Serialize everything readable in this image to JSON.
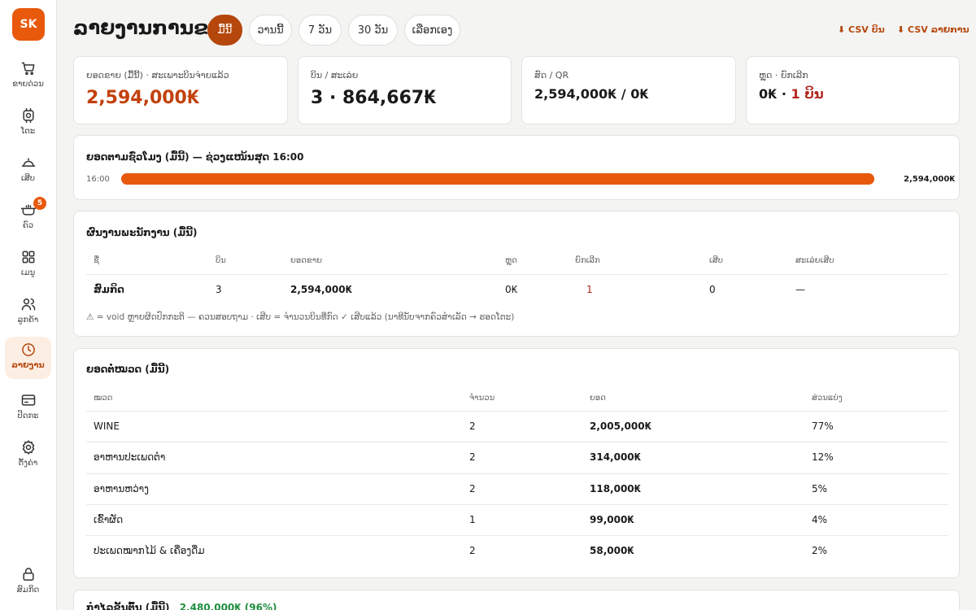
{
  "app": {
    "logo": "SK"
  },
  "sidebar": {
    "items": [
      {
        "label": "ຂາຍດ່ວນ",
        "icon": "cart-icon"
      },
      {
        "label": "ໂຕະ",
        "icon": "table-icon"
      },
      {
        "label": "ເສີບ",
        "icon": "cloche-icon"
      },
      {
        "label": "ຄົວ",
        "icon": "pot-icon",
        "badge": "5"
      },
      {
        "label": "ເມນູ",
        "icon": "grid-icon"
      },
      {
        "label": "ລູກຄ້າ",
        "icon": "users-icon"
      },
      {
        "label": "ລາຍງານ",
        "icon": "clock-icon",
        "active": true
      },
      {
        "label": "ປິດກະ",
        "icon": "card-icon"
      },
      {
        "label": "ຕັ້ງຄ່າ",
        "icon": "gear-icon"
      }
    ],
    "user": {
      "label": "ສົມກິດ",
      "icon": "lock-icon"
    }
  },
  "header": {
    "title": "ລາຍງານການຂາຍ",
    "ranges": [
      "ມື້ນີ້",
      "ວານນີ້",
      "7 ວັນ",
      "30 ວັນ",
      "ເລືອກເອງ"
    ],
    "active_range": "ມື້ນີ້",
    "csv_bills": "⬇ CSV ບິນ",
    "csv_items": "⬇ CSV ລາຍການ"
  },
  "stats": [
    {
      "label": "ຍອດຂາຍ (ມື້ນີ້) · ສະເພາະບິນຈ່າຍແລ້ວ",
      "value": "2,594,000₭"
    },
    {
      "label": "ບິນ / ສະເລ່ຍ",
      "value": "3 · 864,667₭"
    },
    {
      "label": "ສົດ / QR",
      "value": "2,594,000₭ / 0₭"
    },
    {
      "label": "ຫຼຸດ · ຍົກເລີກ",
      "value_main": "0₭ · ",
      "value_alert": "1 ບິນ"
    }
  ],
  "hourly": {
    "title": "ຍອດຕາມຊົ່ວໂມງ (ມື້ນີ້) — ຊ່ວງແໜ້ນສຸດ 16:00",
    "rows": [
      {
        "hour": "16:00",
        "value_label": "2,594,000₭",
        "fraction": 1.0
      }
    ]
  },
  "staff": {
    "title": "ຜົນງານພະນັກງານ (ມື້ນີ້)",
    "headers": [
      "ຊື່",
      "ບິນ",
      "ຍອດຂາຍ",
      "ຫຼຸດ",
      "ຍົກເລີກ",
      "ເສີບ",
      "ສະເລ່ຍເສີບ"
    ],
    "rows": [
      {
        "name": "ສົມກິດ",
        "bills": "3",
        "sales": "2,594,000₭",
        "discount": "0₭",
        "cancel": "1",
        "served": "0",
        "avg_serve": "—"
      }
    ],
    "note": "⚠ = void ຫຼາຍຜິດປົກກະຕິ — ຄວນສອບຖາມ · ເສີບ = ຈຳນວນບິນທີ່ກົດ ✓ ເສີບແລ້ວ (ນາທີນັບຈາກຄົວສຳເລັດ → ຮອດໂຕະ)"
  },
  "category": {
    "title": "ຍອດຕໍ່ໝວດ (ມື້ນີ້)",
    "headers": [
      "ໝວດ",
      "ຈຳນວນ",
      "ຍອດ",
      "ສ່ວນແບ່ງ"
    ],
    "rows": [
      {
        "name": "WINE",
        "qty": "2",
        "amount": "2,005,000₭",
        "share": "77%"
      },
      {
        "name": "ອາຫານປະເພດຕຳ",
        "qty": "2",
        "amount": "314,000₭",
        "share": "12%"
      },
      {
        "name": "ອາຫານຫວ່າງ",
        "qty": "2",
        "amount": "118,000₭",
        "share": "5%"
      },
      {
        "name": "ເຂົ້າຜັດ",
        "qty": "1",
        "amount": "99,000₭",
        "share": "4%"
      },
      {
        "name": "ປະເພດໝາກໄມ້ & ເຄື່ອງດື່ມ",
        "qty": "2",
        "amount": "58,000₭",
        "share": "2%"
      }
    ]
  },
  "bottom_peek": {
    "title": "ກຳໄລຂັ້ນຕົ້ນ (ມື້ນີ້)",
    "value": "2,480,000₭ (96%)"
  },
  "colors": {
    "accent": "#e8590c",
    "accent_dark": "#b5470c",
    "alert": "#b3261e",
    "positive": "#1e8e3e"
  }
}
